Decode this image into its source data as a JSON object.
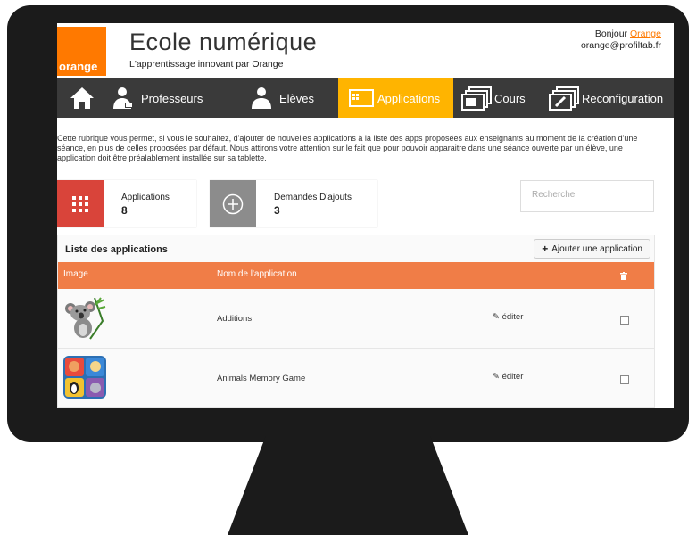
{
  "header": {
    "logo_text": "orange",
    "brand_title": "Ecole numérique",
    "brand_subtitle": "L'apprentissage innovant par Orange",
    "greeting": "Bonjour",
    "user_name": "Orange",
    "user_email": "orange@profiltab.fr"
  },
  "nav": {
    "home_icon": "home-icon",
    "items": [
      {
        "label": "Professeurs",
        "icon": "teacher-icon"
      },
      {
        "label": "Elèves",
        "icon": "student-icon"
      },
      {
        "label": "Applications",
        "icon": "applications-icon",
        "active": true
      },
      {
        "label": "Cours",
        "icon": "cours-icon"
      },
      {
        "label": "Reconfiguration",
        "icon": "reconfiguration-icon"
      }
    ]
  },
  "description": "Cette rubrique vous permet, si vous le souhaitez, d'ajouter de nouvelles applications à la liste des apps proposées aux enseignants au moment de la création d'une séance, en plus de celles proposées par défaut. Nous attirons votre attention sur le fait que pour pouvoir apparaitre dans une séance ouverte par un élève, une application doit être préalablement installée sur sa tablette.",
  "stats": [
    {
      "label": "Applications",
      "value": "8",
      "color": "#d9443a",
      "icon": "grid-icon"
    },
    {
      "label": "Demandes D'ajouts",
      "value": "3",
      "color": "#8c8c8c",
      "icon": "plus-circle-icon"
    }
  ],
  "search": {
    "placeholder": "Recherche"
  },
  "list": {
    "title": "Liste des applications",
    "add_button": "Ajouter une application",
    "columns": {
      "image": "Image",
      "name": "Nom de l'application"
    },
    "rows": [
      {
        "name": "Additions",
        "edit": "éditer",
        "image": "koala-icon"
      },
      {
        "name": "Animals Memory Game",
        "edit": "éditer",
        "image": "animals-memory-icon"
      }
    ]
  },
  "colors": {
    "orange": "#ff7900",
    "nav_bg": "#3a3a3a",
    "active": "#ffb400",
    "table_header": "#f07d47"
  }
}
